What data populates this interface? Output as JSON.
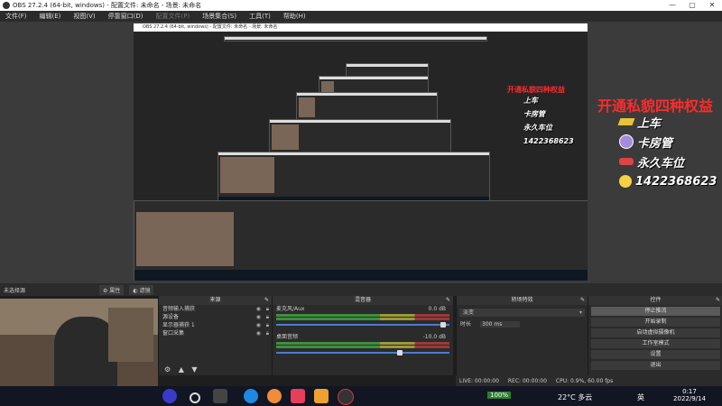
{
  "window": {
    "title": "OBS 27.2.4 (64-bit, windows) - 配置文件: 未命名 - 场景: 未命名",
    "controls": [
      "—",
      "▢",
      "✕"
    ]
  },
  "menu": [
    "文件(F)",
    "编辑(E)",
    "视图(V)",
    "停靠窗口(D)",
    "配置文件(P)",
    "场景集合(S)",
    "工具(T)",
    "帮助(H)"
  ],
  "overlay": {
    "title": "开通私貌四种权益",
    "items": [
      "上车",
      "卡房管",
      "永久车位",
      "1422368623"
    ]
  },
  "scenebar": {
    "label": "未选择源",
    "properties": "属性",
    "filters": "滤镜"
  },
  "sources": {
    "title": "来源",
    "items": [
      "音频输入捕获",
      "源设备",
      "显示器捕获 1",
      "窗口采集"
    ]
  },
  "mixer": {
    "title": "混音器",
    "channels": [
      {
        "name": "麦克风/Aux",
        "db": "0.0 dB",
        "level": 0.95
      },
      {
        "name": "桌面音频",
        "db": "-10.0 dB",
        "level": 0.7
      }
    ]
  },
  "transitions": {
    "title": "转场特效",
    "type": "淡变",
    "duration_label": "时长",
    "duration": "300 ms"
  },
  "controls": {
    "title": "控件",
    "buttons": [
      "停止推流",
      "开始录制",
      "启动虚拟摄像机",
      "工作室模式",
      "设置",
      "退出"
    ]
  },
  "status": {
    "live": "LIVE: 00:00:00",
    "rec": "REC: 00:00:00",
    "cpu": "CPU: 0.9%, 60.00 fps"
  },
  "taskbar": {
    "weather": "22°C 多云",
    "ime": "英",
    "time": "0:17",
    "date": "2022/9/14",
    "battery": "100%"
  }
}
